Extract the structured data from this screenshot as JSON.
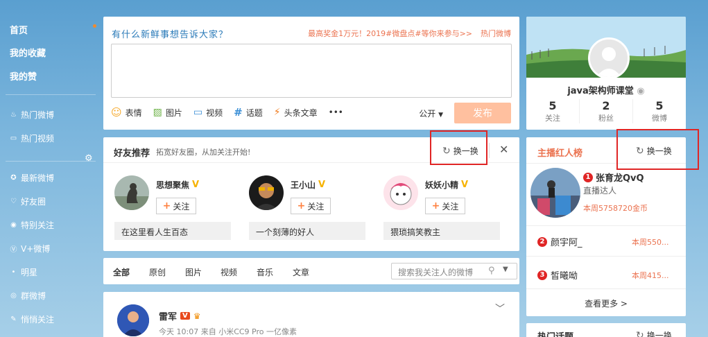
{
  "nav": {
    "items": [
      {
        "label": "首页",
        "icon": ""
      },
      {
        "label": "我的收藏",
        "icon": ""
      },
      {
        "label": "我的赞",
        "icon": ""
      },
      {
        "label": "热门微博",
        "icon": "fire-icon"
      },
      {
        "label": "热门视频",
        "icon": "video-icon"
      },
      {
        "label": "最新微博",
        "icon": "star-icon"
      },
      {
        "label": "好友圈",
        "icon": "heart-icon"
      },
      {
        "label": "特别关注",
        "icon": "target-icon"
      },
      {
        "label": "V+微博",
        "icon": "vplus-icon"
      },
      {
        "label": "明星",
        "icon": "dot-icon"
      },
      {
        "label": "群微博",
        "icon": "group-icon"
      },
      {
        "label": "悄悄关注",
        "icon": "feather-icon"
      }
    ]
  },
  "composer": {
    "prompt": "有什么新鲜事想告诉大家？",
    "promo": "最高奖金1万元！2019#微盘点#等你来参与>>",
    "hot": "热门微博",
    "tools": [
      "表情",
      "图片",
      "视频",
      "话题",
      "头条文章",
      "•••"
    ],
    "public": "公开",
    "publish": "发布"
  },
  "friends": {
    "title": "好友推荐",
    "subtitle": "拓宽好友圈，从加关注开始!",
    "refresh": "换一换",
    "follow": "关注",
    "people": [
      {
        "name": "思想聚焦",
        "desc": "在这里看人生百态"
      },
      {
        "name": "王小山",
        "desc": "一个刻薄的好人"
      },
      {
        "name": "妖妖小精",
        "desc": "猥琐搞笑教主"
      }
    ]
  },
  "tabs": {
    "items": [
      "全部",
      "原创",
      "图片",
      "视频",
      "音乐",
      "文章"
    ],
    "search_placeholder": "搜索我关注人的微博"
  },
  "post": {
    "name": "雷军",
    "meta": "今天 10:07 来自 小米CC9 Pro 一亿像素"
  },
  "profile": {
    "name": "java架构师课堂",
    "stats": [
      {
        "n": "5",
        "l": "关注"
      },
      {
        "n": "2",
        "l": "粉丝"
      },
      {
        "n": "5",
        "l": "微博"
      }
    ]
  },
  "hosts": {
    "title": "主播红人榜",
    "refresh": "换一换",
    "first": {
      "rank": "1",
      "name": "张育龙QvQ",
      "role": "直播达人",
      "score": "本周5758720金币"
    },
    "others": [
      {
        "rank": "2",
        "name": "颜宇阿_",
        "score": "本周550..."
      },
      {
        "rank": "3",
        "name": "皙曦呦",
        "score": "本周415..."
      }
    ],
    "more": "查看更多 >"
  },
  "topics": {
    "title": "热门话题",
    "refresh": "换一换"
  },
  "colors": {
    "accent": "#eb7350",
    "link": "#2a7ab8",
    "highlight": "#e02525"
  }
}
